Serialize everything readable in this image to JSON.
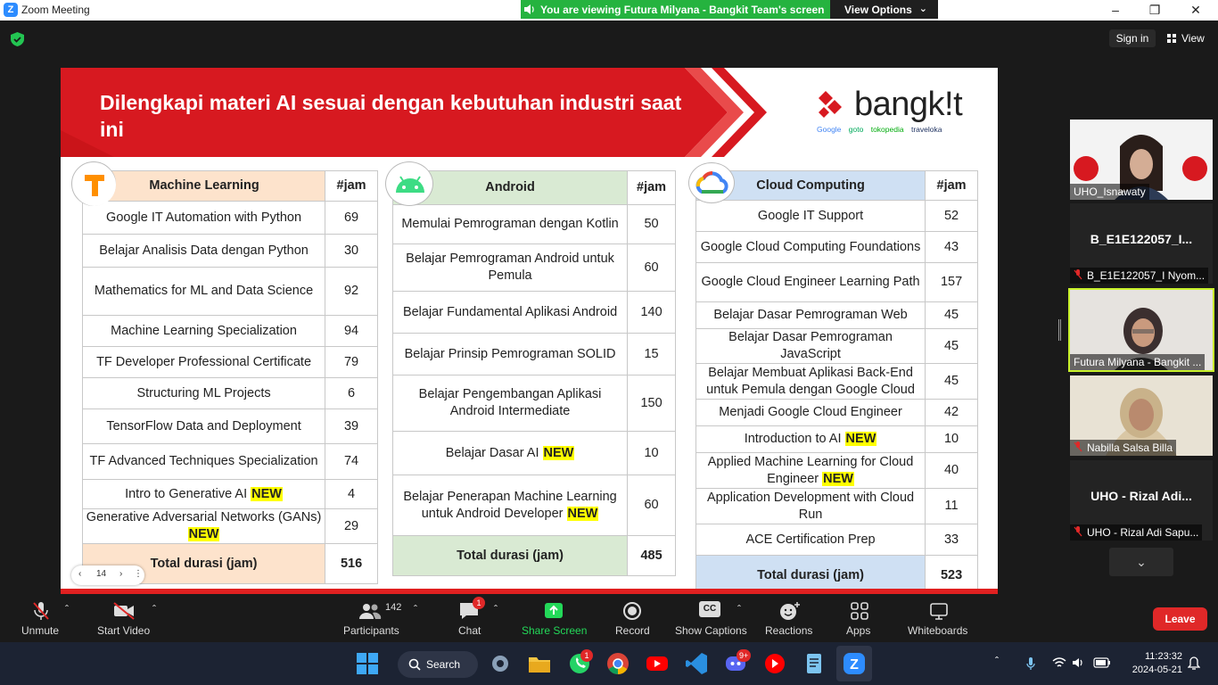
{
  "window": {
    "title": "Zoom Meeting",
    "sharing_banner": "You are viewing Futura Milyana - Bangkit Team's screen",
    "view_options_label": "View Options",
    "sign_in_label": "Sign in",
    "view_label": "View"
  },
  "slide": {
    "title": "Dilengkapi materi AI sesuai dengan kebutuhan industri saat ini",
    "logo_text": "bangk!t",
    "partners": [
      "Google",
      "goto",
      "tokopedia",
      "traveloka"
    ],
    "page_number": "14",
    "new_tag": "NEW",
    "hours_header": "#jam",
    "total_label": "Total durasi (jam)",
    "columns": [
      {
        "name": "Machine Learning",
        "header_color": "#fde3cc",
        "courses": [
          {
            "name": "Google IT Automation with Python",
            "hours": "69",
            "new": false
          },
          {
            "name": "Belajar Analisis Data dengan Python",
            "hours": "30",
            "new": false
          },
          {
            "name": "Mathematics for ML and Data Science",
            "hours": "92",
            "new": false
          },
          {
            "name": "Machine Learning Specialization",
            "hours": "94",
            "new": false
          },
          {
            "name": "TF Developer Professional Certificate",
            "hours": "79",
            "new": false
          },
          {
            "name": "Structuring ML Projects",
            "hours": "6",
            "new": false
          },
          {
            "name": "TensorFlow Data and Deployment",
            "hours": "39",
            "new": false
          },
          {
            "name": "TF Advanced Techniques Specialization",
            "hours": "74",
            "new": false
          },
          {
            "name": "Intro to Generative AI",
            "hours": "4",
            "new": true
          },
          {
            "name": "Generative Adversarial Networks (GANs)",
            "hours": "29",
            "new": true
          }
        ],
        "total": "516"
      },
      {
        "name": "Android",
        "header_color": "#d9ead3",
        "courses": [
          {
            "name": "Memulai Pemrograman dengan Kotlin",
            "hours": "50",
            "new": false
          },
          {
            "name": "Belajar Pemrograman Android untuk Pemula",
            "hours": "60",
            "new": false
          },
          {
            "name": "Belajar Fundamental Aplikasi Android",
            "hours": "140",
            "new": false
          },
          {
            "name": "Belajar Prinsip Pemrograman SOLID",
            "hours": "15",
            "new": false
          },
          {
            "name": "Belajar Pengembangan Aplikasi Android Intermediate",
            "hours": "150",
            "new": false
          },
          {
            "name": "Belajar Dasar AI",
            "hours": "10",
            "new": true
          },
          {
            "name": "Belajar Penerapan Machine Learning untuk Android Developer",
            "hours": "60",
            "new": true
          }
        ],
        "total": "485"
      },
      {
        "name": "Cloud Computing",
        "header_color": "#cfe0f3",
        "courses": [
          {
            "name": "Google IT Support",
            "hours": "52",
            "new": false
          },
          {
            "name": "Google Cloud Computing Foundations",
            "hours": "43",
            "new": false
          },
          {
            "name": "Google Cloud Engineer Learning Path",
            "hours": "157",
            "new": false
          },
          {
            "name": "Belajar Dasar Pemrograman Web",
            "hours": "45",
            "new": false
          },
          {
            "name": "Belajar Dasar Pemrograman JavaScript",
            "hours": "45",
            "new": false
          },
          {
            "name": "Belajar Membuat Aplikasi Back-End untuk Pemula dengan Google Cloud",
            "hours": "45",
            "new": false
          },
          {
            "name": "Menjadi Google Cloud Engineer",
            "hours": "42",
            "new": false
          },
          {
            "name": "Introduction to AI",
            "hours": "10",
            "new": true
          },
          {
            "name": "Applied Machine Learning for Cloud Engineer",
            "hours": "40",
            "new": true
          },
          {
            "name": "Application Development with Cloud Run",
            "hours": "11",
            "new": false
          },
          {
            "name": "ACE Certification Prep",
            "hours": "33",
            "new": false
          }
        ],
        "total": "523"
      }
    ]
  },
  "participants": {
    "tiles": [
      {
        "name": "UHO_Isnawaty",
        "big": "",
        "video": true,
        "muted": false
      },
      {
        "name": "B_E1E122057_I Nyom...",
        "big": "B_E1E122057_I...",
        "video": false,
        "muted": true
      },
      {
        "name": "Futura Milyana - Bangkit ...",
        "big": "",
        "video": true,
        "muted": false,
        "active": true
      },
      {
        "name": "Nabilla Salsa Billa",
        "big": "",
        "video": true,
        "muted": true
      },
      {
        "name": "UHO - Rizal Adi Sapu...",
        "big": "UHO - Rizal Adi...",
        "video": false,
        "muted": true
      }
    ]
  },
  "toolbar": {
    "unmute": "Unmute",
    "start_video": "Start Video",
    "participants": "Participants",
    "participants_count": "142",
    "chat": "Chat",
    "chat_badge": "1",
    "share_screen": "Share Screen",
    "record": "Record",
    "captions_icon": "CC",
    "show_captions": "Show Captions",
    "reactions": "Reactions",
    "apps": "Apps",
    "whiteboards": "Whiteboards",
    "leave": "Leave",
    "share_color": "#23d959"
  },
  "taskbar": {
    "search": "Search",
    "time": "11:23:32",
    "date": "2024-05-21",
    "whatsapp_badge": "1",
    "discord_badge": "9+"
  }
}
